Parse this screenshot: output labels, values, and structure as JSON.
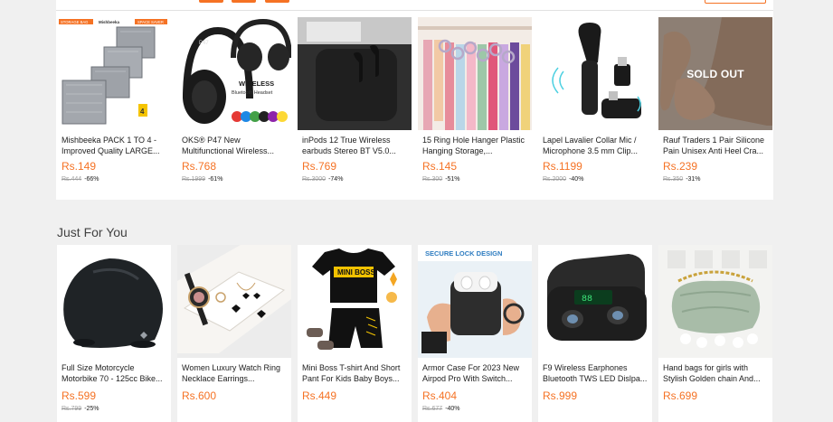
{
  "flash_sale": {
    "items": [
      {
        "title": "Mishbeeka PACK 1 TO 4 - Improved Quality LARGE...",
        "price": "Rs.149",
        "original": "Rs.444",
        "discount": "-66%",
        "image": "storage-bags-image"
      },
      {
        "title": "OKS® P47 New Multifunctional Wireless...",
        "price": "Rs.768",
        "original": "Rs.1999",
        "discount": "-61%",
        "image": "headphones-image"
      },
      {
        "title": "inPods 12 True Wireless earbuds Stereo BT V5.0...",
        "price": "Rs.769",
        "original": "Rs.3000",
        "discount": "-74%",
        "image": "earbuds-image"
      },
      {
        "title": "15 Ring Hole Hanger Plastic Hanging Storage,...",
        "price": "Rs.145",
        "original": "Rs.300",
        "discount": "-51%",
        "image": "scarf-hanger-image"
      },
      {
        "title": "Lapel Lavalier Collar Mic / Microphone 3.5 mm Clip...",
        "price": "Rs.1199",
        "original": "Rs.2000",
        "discount": "-40%",
        "image": "lapel-mic-image"
      },
      {
        "title": "Rauf Traders 1 Pair Silicone Pain Unisex Anti Heel Cra...",
        "price": "Rs.239",
        "original": "Rs.350",
        "discount": "-31%",
        "image": "heel-pad-image",
        "badge": "SOLD OUT"
      }
    ]
  },
  "just_for_you": {
    "title": "Just For You",
    "items": [
      {
        "title": "Full Size Motorcycle Motorbike 70 - 125cc Bike...",
        "price": "Rs.599",
        "original": "Rs.799",
        "discount": "-25%",
        "image": "bike-cover-image"
      },
      {
        "title": "Women Luxury Watch Ring Necklace Earrings...",
        "price": "Rs.600",
        "original": "",
        "discount": "",
        "image": "watch-set-image"
      },
      {
        "title": "Mini Boss T-shirt And Short Pant For Kids Baby Boys...",
        "price": "Rs.449",
        "original": "",
        "discount": "",
        "image": "kids-outfit-image"
      },
      {
        "title": "Armor Case For 2023 New Airpod Pro With Switch...",
        "price": "Rs.404",
        "original": "Rs.677",
        "discount": "-40%",
        "image": "airpod-case-image"
      },
      {
        "title": "F9 Wireless Earphones Bluetooth TWS LED Dislpa...",
        "price": "Rs.999",
        "original": "",
        "discount": "",
        "image": "f9-earphones-image"
      },
      {
        "title": "Hand bags for girls with Stylish Golden chain And...",
        "price": "Rs.699",
        "original": "",
        "discount": "",
        "image": "handbag-image"
      }
    ]
  },
  "image_text": {
    "storage_tag1": "STORAGE BAG",
    "storage_brand": "Mishbeeka",
    "storage_tag2": "SPACE SAVER",
    "storage_count": "4",
    "headphone_brand": "P47",
    "headphone_label1": "WIRELESS",
    "headphone_label2": "Bluetooth Headset",
    "kids_shirt": "MINI BOSS",
    "case_heading": "SECURE LOCK DESIGN",
    "f9_display": "88"
  },
  "colors": {
    "accent": "#f57224",
    "background": "#f0f0f0",
    "card": "#ffffff"
  }
}
